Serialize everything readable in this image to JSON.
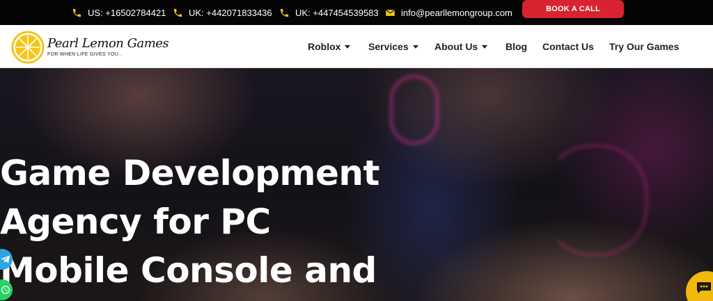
{
  "topbar": {
    "contacts": [
      {
        "icon": "phone-icon",
        "text": "US: +16502784421"
      },
      {
        "icon": "phone-icon",
        "text": "UK: +442071833436"
      },
      {
        "icon": "phone-icon",
        "text": "UK: +447454539583"
      },
      {
        "icon": "envelope-icon",
        "text": "info@pearllemongroup.com"
      }
    ],
    "book_label": "BOOK A CALL",
    "icon_color": "#f5c518",
    "button_color": "#d9232e"
  },
  "logo": {
    "name": "Pearl Lemon Games",
    "tagline": "FOR WHEN LIFE GIVES YOU..",
    "color": "#f5c518"
  },
  "nav": {
    "items": [
      {
        "label": "Roblox",
        "has_dropdown": true
      },
      {
        "label": "Services",
        "has_dropdown": true
      },
      {
        "label": "About Us",
        "has_dropdown": true
      },
      {
        "label": "Blog",
        "has_dropdown": false
      },
      {
        "label": "Contact Us",
        "has_dropdown": false
      },
      {
        "label": "Try Our Games",
        "has_dropdown": false
      }
    ]
  },
  "hero": {
    "title_lines": [
      "Game Development",
      "Agency for PC",
      "Mobile Console and"
    ]
  },
  "widgets": {
    "telegram_icon": "telegram-icon",
    "whatsapp_icon": "whatsapp-icon",
    "chat_icon": "chat-icon"
  }
}
